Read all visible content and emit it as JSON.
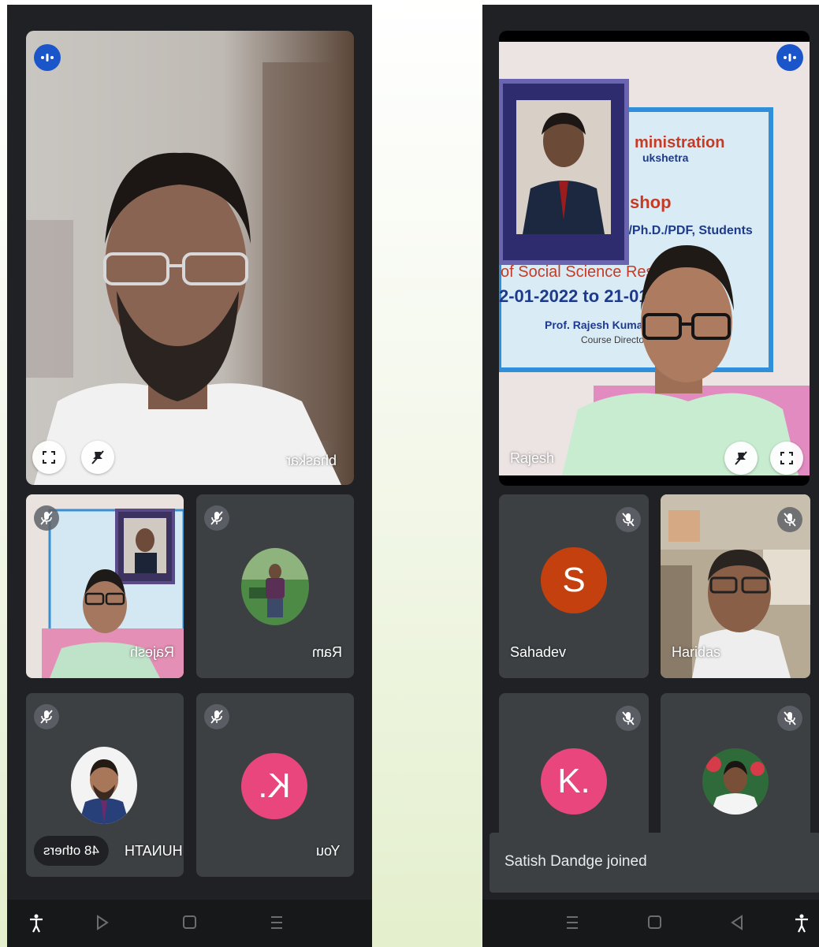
{
  "left_phone": {
    "main_speaker": {
      "name": "bhaskar"
    },
    "tiles": [
      {
        "name": "Rajesh"
      },
      {
        "name": "Ram"
      },
      {
        "name": "RAGHUNATH"
      },
      {
        "name": "You",
        "initial": "K."
      }
    ],
    "others_chip": "48 others"
  },
  "right_phone": {
    "main_speaker": {
      "name": "Rajesh"
    },
    "tiles": [
      {
        "name": "Sahadev",
        "initial": "S"
      },
      {
        "name": "Haridas"
      },
      {
        "name": "",
        "initial": "K."
      },
      {
        "name": ""
      }
    ],
    "toast": "Satish Dandge joined"
  },
  "banner_text": {
    "line1": "ministration",
    "line2": "ukshetra",
    "line3": "shop",
    "line4": "I/Ph.D./PDF, Students",
    "line5": "of Social Science Resea",
    "line6": "2-01-2022 to 21-01-20",
    "line7": "Prof. Rajesh Kumar",
    "line8": "Course Director"
  },
  "colors": {
    "screen_bg": "#202124",
    "tile_bg": "#3c4043",
    "avatar_s": "#c5400f",
    "avatar_k": "#e8467c",
    "voice_indicator": "#1a56c9",
    "navbar": "#17181a"
  },
  "icons": {
    "mute": "mic-off-icon",
    "fullscreen": "fullscreen-icon",
    "pin_off": "pin-off-icon",
    "voice": "voice-activity-icon",
    "accessibility": "accessibility-icon"
  }
}
